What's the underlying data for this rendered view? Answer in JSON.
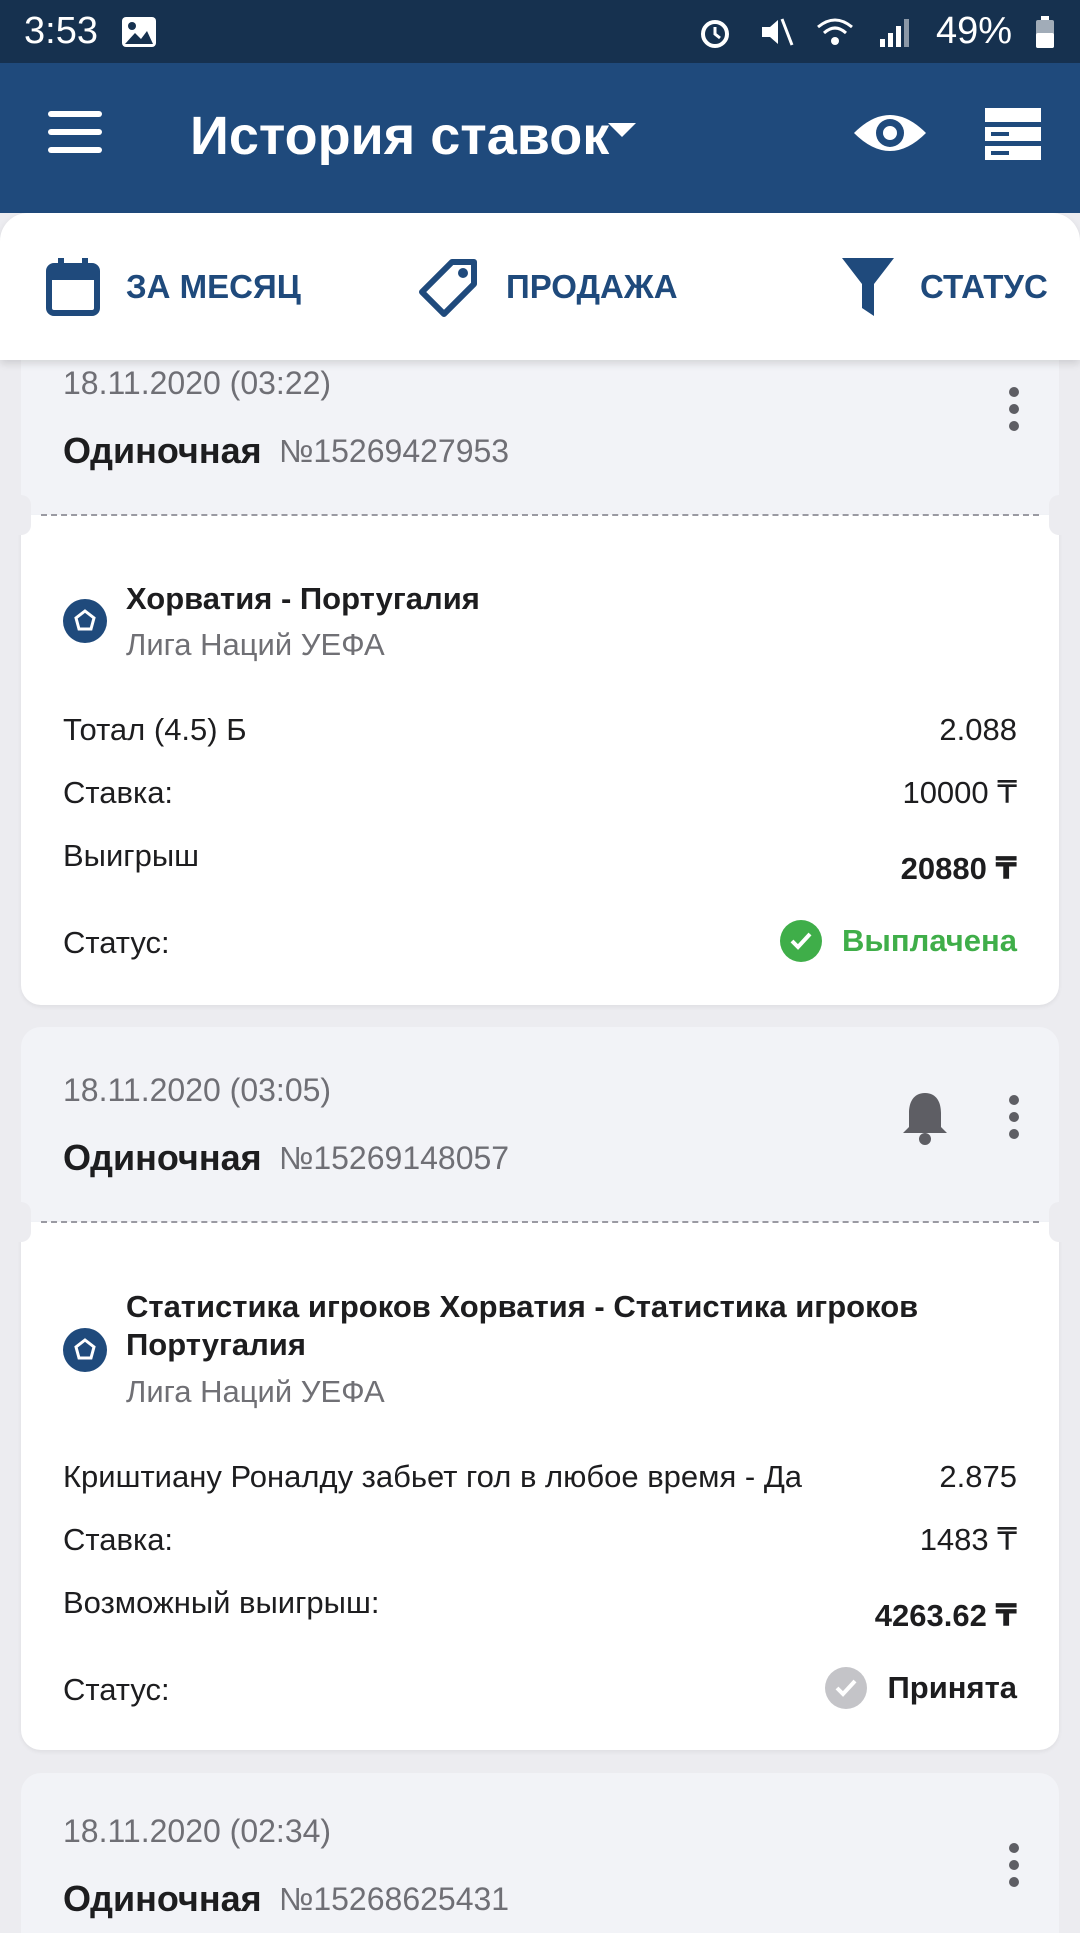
{
  "status_bar": {
    "time": "3:53",
    "battery": "49%"
  },
  "appbar": {
    "title": "История ставок"
  },
  "filters": [
    {
      "label": "ЗА МЕСЯЦ"
    },
    {
      "label": "ПРОДАЖА"
    },
    {
      "label": "СТАТУС"
    }
  ],
  "bets": [
    {
      "date": "18.11.2020 (03:22)",
      "type": "Одиночная",
      "number": "№15269427953",
      "match": "Хорватия - Португалия",
      "league": "Лига Наций УЕФА",
      "market": "Тотал (4.5) Б",
      "odds": "2.088",
      "stake_label": "Ставка:",
      "stake": "10000 ₸",
      "win_label": "Выигрыш",
      "win": "20880 ₸",
      "status_label": "Статус:",
      "status": "Выплачена",
      "status_color": "#3fae49"
    },
    {
      "date": "18.11.2020 (03:05)",
      "type": "Одиночная",
      "number": "№15269148057",
      "match": "Статистика игроков Хорватия - Статистика игроков Португалия",
      "league": "Лига Наций УЕФА",
      "market": "Криштиану Роналду забьет гол в любое время - Да",
      "odds": "2.875",
      "stake_label": "Ставка:",
      "stake": "1483 ₸",
      "win_label": "Возможный выигрыш:",
      "win": "4263.62 ₸",
      "status_label": "Статус:",
      "status": "Принята",
      "status_color": "#c4c4c8"
    },
    {
      "date": "18.11.2020 (02:34)",
      "type": "Одиночная",
      "number": "№15268625431"
    }
  ]
}
